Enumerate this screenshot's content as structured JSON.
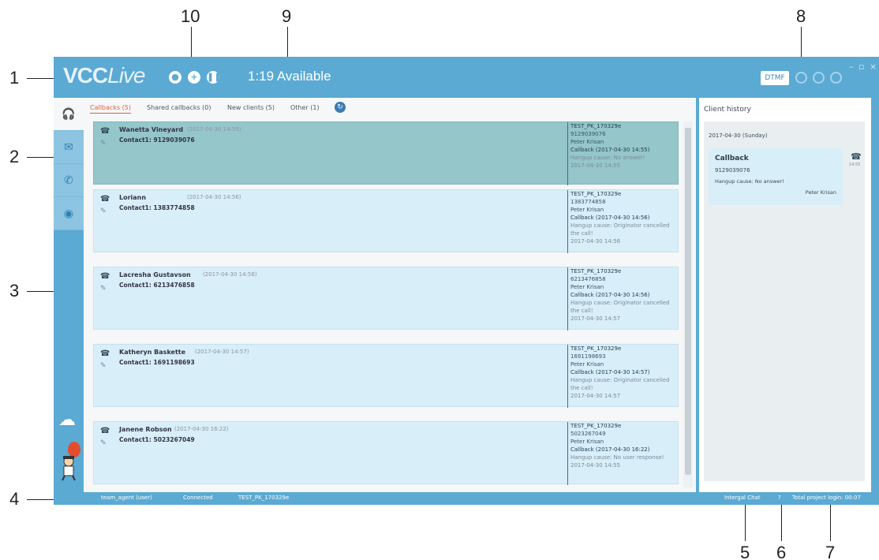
{
  "callouts": [
    "1",
    "2",
    "3",
    "4",
    "5",
    "6",
    "7",
    "8",
    "9",
    "10"
  ],
  "app": {
    "logo_bold": "VCC",
    "logo_light": "Live",
    "status_text": "1:19 Available",
    "dtmf_label": "DTMF",
    "icons": [
      "eye-icon",
      "plus-circle-icon",
      "pause-icon"
    ]
  },
  "rail": {
    "items": [
      "headset-icon",
      "envelope-icon",
      "phone-icon",
      "globe-icon"
    ]
  },
  "tabs": [
    {
      "label": "Callbacks (5)",
      "active": true
    },
    {
      "label": "Shared callbacks (0)",
      "active": false
    },
    {
      "label": "New clients (5)",
      "active": false
    },
    {
      "label": "Other (1)",
      "active": false
    }
  ],
  "cards": [
    {
      "name": "Wanetta Vineyard",
      "time": "(2017-04-30 14:55)",
      "contact": "Contact1: 9129039076",
      "project": "TEST_PK_170329e",
      "number": "9129039076",
      "agent": "Peter Krisan",
      "callback": "Callback (2017-04-30 14:55)",
      "cause": "Hangup cause: No answer!",
      "date": "2017-04-30 14:55"
    },
    {
      "name": "Loriann",
      "time": "(2017-04-30 14:56)",
      "contact": "Contact1: 1383774858",
      "project": "TEST_PK_170329e",
      "number": "1383774858",
      "agent": "Peter Krisan",
      "callback": "Callback (2017-04-30 14:56)",
      "cause": "Hangup cause: Originator cancelled the call!",
      "date": "2017-04-30 14:56"
    },
    {
      "name": "Lacresha Gustavson",
      "time": "(2017-04-30 14:56)",
      "contact": "Contact1: 6213476858",
      "project": "TEST_PK_170329e",
      "number": "6213476858",
      "agent": "Peter Krisan",
      "callback": "Callback (2017-04-30 14:56)",
      "cause": "Hangup cause: Originator cancelled the call!",
      "date": "2017-04-30 14:57"
    },
    {
      "name": "Katheryn Baskette",
      "time": "(2017-04-30 14:57)",
      "contact": "Contact1: 1691198693",
      "project": "TEST_PK_170329e",
      "number": "1691198693",
      "agent": "Peter Krisan",
      "callback": "Callback (2017-04-30 14:57)",
      "cause": "Hangup cause: Originator cancelled the call!",
      "date": "2017-04-30 14:57"
    },
    {
      "name": "Janene Robson",
      "time": "(2017-04-30 16:22)",
      "contact": "Contact1: 5023267049",
      "project": "TEST_PK_170329e",
      "number": "5023267049",
      "agent": "Peter Krisan",
      "callback": "Callback (2017-04-30 16:22)",
      "cause": "Hangup cause: No user response!",
      "date": "2017-04-30 14:55"
    }
  ],
  "history": {
    "title": "Client history",
    "date": "2017-04-30 (Sunday)",
    "card_title": "Callback",
    "card_number": "9129039076",
    "card_cause": "Hangup cause: No answer!",
    "card_agent": "Peter Krisan",
    "phone_time": "14:55"
  },
  "statusbar": {
    "agent": "team_agent (user)",
    "connected": "Connected",
    "project": "TEST_PK_170329e",
    "chat": "Intergal Chat",
    "login": "Total project login: 00:07"
  },
  "colors": {
    "accent": "#5aaad4",
    "selected": "#95c6c9",
    "card": "#d8eef8",
    "active_tab": "#e35d43"
  }
}
